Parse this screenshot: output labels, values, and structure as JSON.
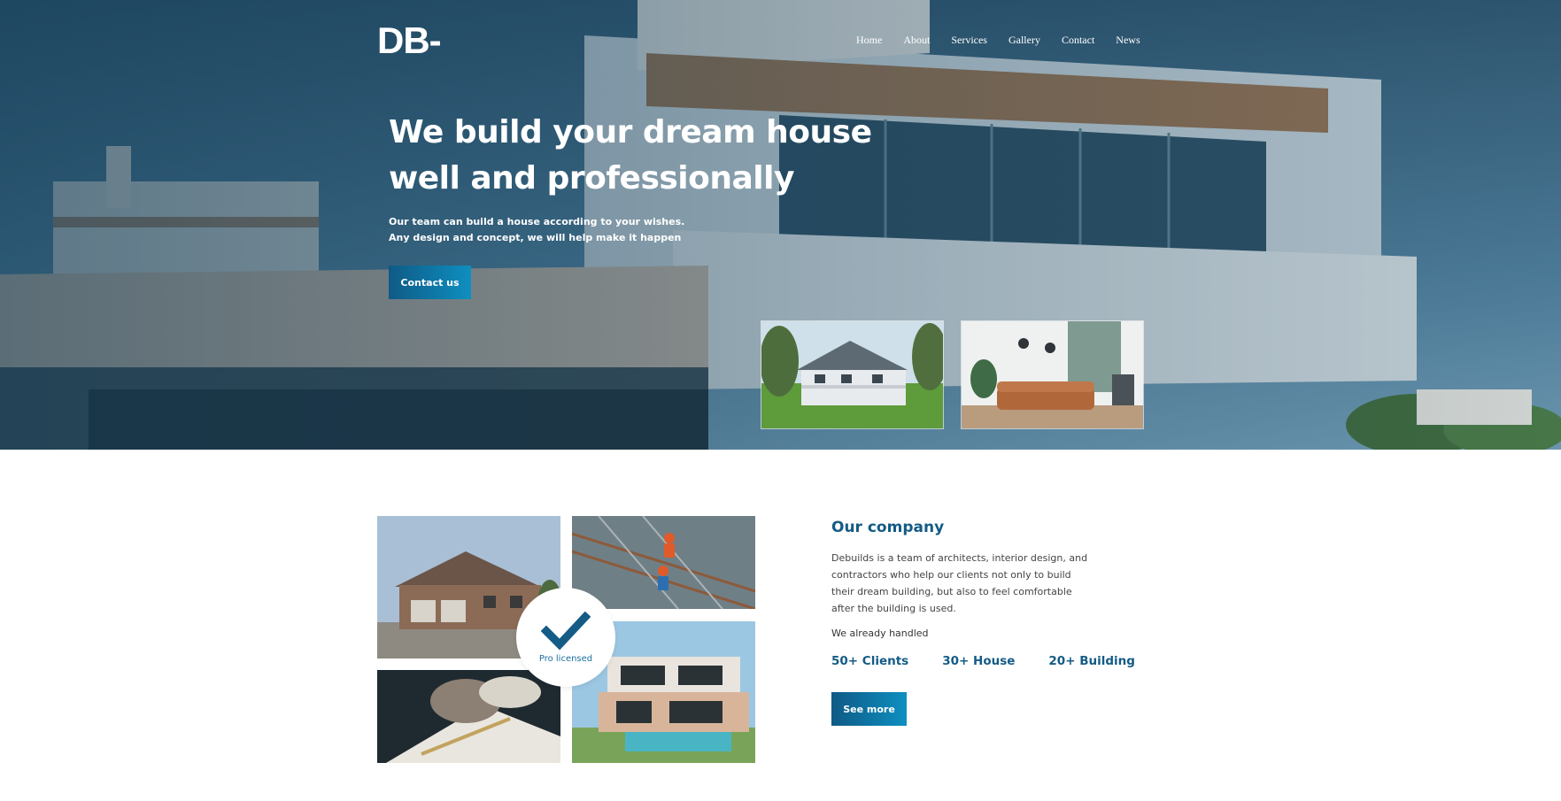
{
  "brand": {
    "logo_text": "DB-"
  },
  "nav": {
    "items": [
      {
        "label": "Home"
      },
      {
        "label": "About"
      },
      {
        "label": "Services"
      },
      {
        "label": "Gallery"
      },
      {
        "label": "Contact"
      },
      {
        "label": "News"
      }
    ]
  },
  "hero": {
    "title_line1": "We build your dream house",
    "title_line2": "well and professionally",
    "subtitle_line1": "Our team can build a house according to your wishes.",
    "subtitle_line2": "Any design and concept, we will help make it happen",
    "cta_label": "Contact us"
  },
  "badge": {
    "label": "Pro licensed",
    "icon": "checkmark-icon"
  },
  "company": {
    "title": "Our company",
    "description": "Debuilds is a team of architects, interior design, and contractors who help our clients not only to build their dream building, but also to feel comfortable after the building is used.",
    "handled_label": "We already handled",
    "stats": [
      {
        "label": "50+ Clients"
      },
      {
        "label": "30+ House"
      },
      {
        "label": "20+ Building"
      }
    ],
    "cta_label": "See more"
  },
  "colors": {
    "accent_dark": "#0f5a86",
    "accent_light": "#0e8fc0",
    "heading_blue": "#145b86"
  }
}
